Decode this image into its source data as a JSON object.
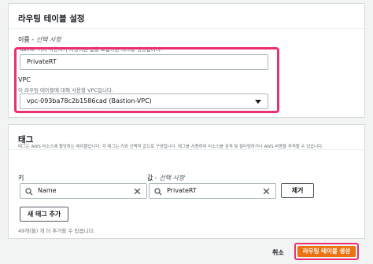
{
  "route_table_settings": {
    "title": "라우팅 테이블 설정",
    "name_label": "이름 -",
    "name_optional": "선택 사항",
    "name_description": "'Name' 키와 사용자가 지정하는 값을 포함하는 태그를 생성합니다.",
    "name_value": "PrivateRT",
    "vpc_label": "VPC",
    "vpc_description": "이 라우팅 테이블에 대해 사용할 VPC입니다.",
    "vpc_value": "vpc-093ba78c2b1586cad (Bastion-VPC)"
  },
  "tags": {
    "title": "태그",
    "description": "태그는 AWS 리소스에 할당하는 레이블입니다. 각 태그는 키와 선택적 값으로 구성됩니다. 태그를 사용하여 리소스를 검색 및 필터링하거나 AWS 비용을 추적할 수 있습니다.",
    "key_label": "키",
    "value_label": "값 -",
    "value_optional": "선택 사항",
    "key_value": "Name",
    "value_value": "PrivateRT",
    "remove_label": "제거",
    "add_label": "새 태그 추가",
    "limit_text": "49개(을) 개 더 추가할 수 있습니다."
  },
  "footer": {
    "cancel_label": "취소",
    "create_label": "라우팅 테이블 생성"
  },
  "colors": {
    "highlight": "#ec2f73",
    "primary_button": "#ec7211"
  },
  "icons": {
    "search": "search-icon",
    "clear": "clear-icon",
    "dropdown": "caret-down-icon"
  }
}
